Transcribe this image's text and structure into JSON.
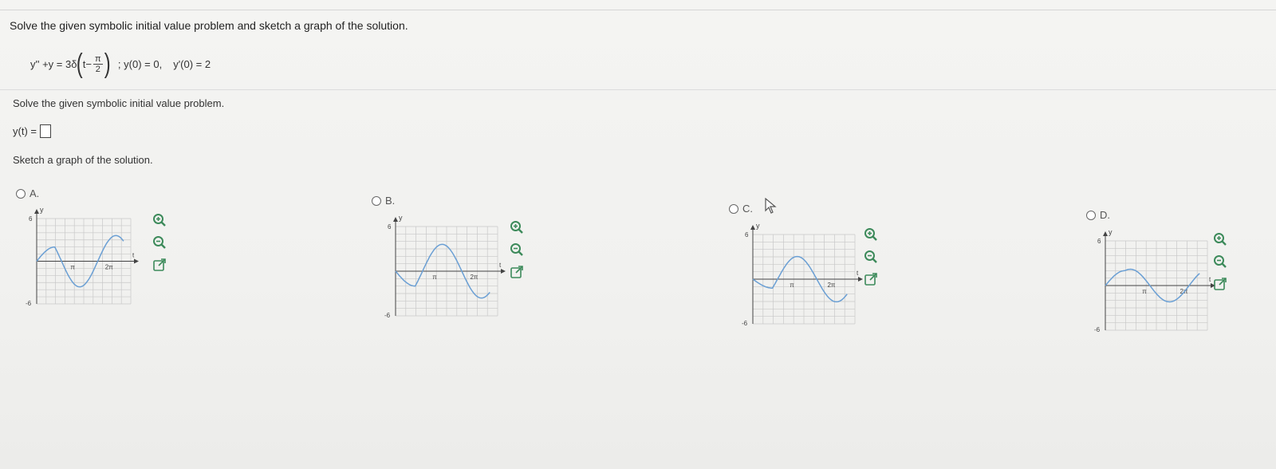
{
  "question": {
    "prompt": "Solve the given symbolic initial value problem and sketch a graph of the solution.",
    "equation": {
      "lhs": "y'' +y = 3δ",
      "arg_prefix": "t−",
      "frac_num": "π",
      "frac_den": "2",
      "ic1": "; y(0) = 0,",
      "ic2": "y'(0) = 2"
    },
    "subprompt": "Solve the given symbolic initial value problem.",
    "answer_label": "y(t) =",
    "answer_value": "",
    "sketch_prompt": "Sketch a graph of the solution."
  },
  "axis_labels": {
    "y": "y",
    "t": "t",
    "ytop": "6",
    "ybot": "-6",
    "pi": "π",
    "twopi": "2π"
  },
  "choices": [
    {
      "label": "A.",
      "selected": false
    },
    {
      "label": "B.",
      "selected": false
    },
    {
      "label": "C.",
      "selected": false
    },
    {
      "label": "D.",
      "selected": false
    }
  ],
  "colors": {
    "curve": "#6a9fd4",
    "grid": "#c8c8c8",
    "axis": "#444444",
    "tool_icon": "#3c8a5a"
  },
  "icons": [
    "zoom-in-icon",
    "zoom-out-icon",
    "open-window-icon",
    "mouse-pointer-icon"
  ]
}
